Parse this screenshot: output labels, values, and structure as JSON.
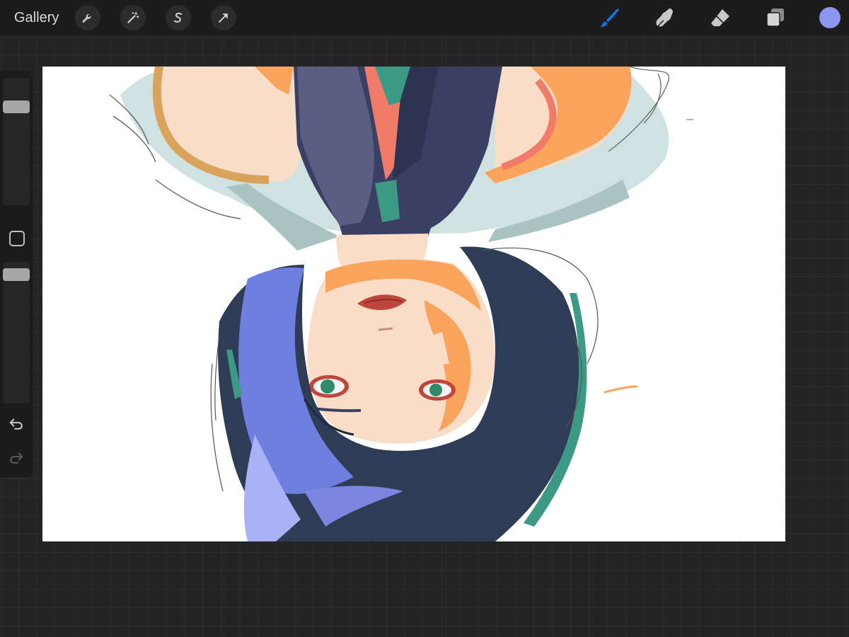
{
  "topbar": {
    "gallery_label": "Gallery",
    "left_tools": [
      {
        "name": "actions",
        "icon": "wrench-icon"
      },
      {
        "name": "adjustments",
        "icon": "magic-wand-icon"
      },
      {
        "name": "selection",
        "icon": "selection-s-icon"
      },
      {
        "name": "transform",
        "icon": "arrow-cursor-icon"
      }
    ],
    "right_tools": [
      {
        "name": "brush",
        "icon": "brush-icon",
        "active": true
      },
      {
        "name": "smudge",
        "icon": "smudge-finger-icon",
        "active": false
      },
      {
        "name": "eraser",
        "icon": "eraser-icon",
        "active": false
      },
      {
        "name": "layers",
        "icon": "layers-icon",
        "active": false
      }
    ],
    "current_color": "#8c95ef"
  },
  "sidebar": {
    "brush_size_level": 0.2,
    "opacity_level": 0.95,
    "modify_icon": "square-outline-icon",
    "undo_icon": "undo-arrow-icon",
    "redo_icon": "redo-arrow-icon"
  },
  "colors": {
    "accent_blue": "#1a73e8",
    "toolbar_bg": "#1c1c1c",
    "canvas_bg": "#ffffff",
    "skin": "#f9ddc8",
    "orange": "#f9a35c",
    "coral": "#f07b68",
    "navy": "#343a5c",
    "hair_dark": "#2f3c55",
    "hair_blue": "#6f7fe0",
    "teal": "#3c9a84",
    "pale_teal": "#cfe1e0"
  }
}
